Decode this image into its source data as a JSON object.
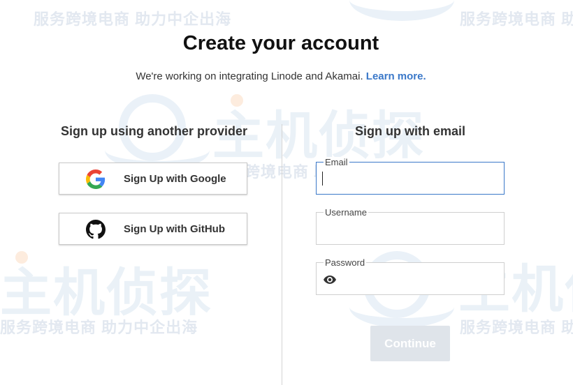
{
  "page": {
    "title": "Create your account",
    "subtitle_text": "We're working on integrating Linode and Akamai. ",
    "subtitle_link": "Learn more."
  },
  "providers": {
    "heading": "Sign up using another provider",
    "google_label": "Sign Up with Google",
    "github_label": "Sign Up with GitHub"
  },
  "email_form": {
    "heading": "Sign up with email",
    "email_label": "Email",
    "email_value": "",
    "username_label": "Username",
    "username_value": "",
    "password_label": "Password",
    "password_value": "",
    "continue_label": "Continue"
  },
  "watermark": {
    "tagline": "服务跨境电商 助力中企出海",
    "brand": "主机侦探"
  },
  "colors": {
    "link": "#3a78c9",
    "focus_border": "#3a78c9",
    "disabled_button": "#dfe4ea"
  },
  "icons": {
    "google": "google-icon",
    "github": "github-icon",
    "password_toggle": "eye-icon"
  }
}
